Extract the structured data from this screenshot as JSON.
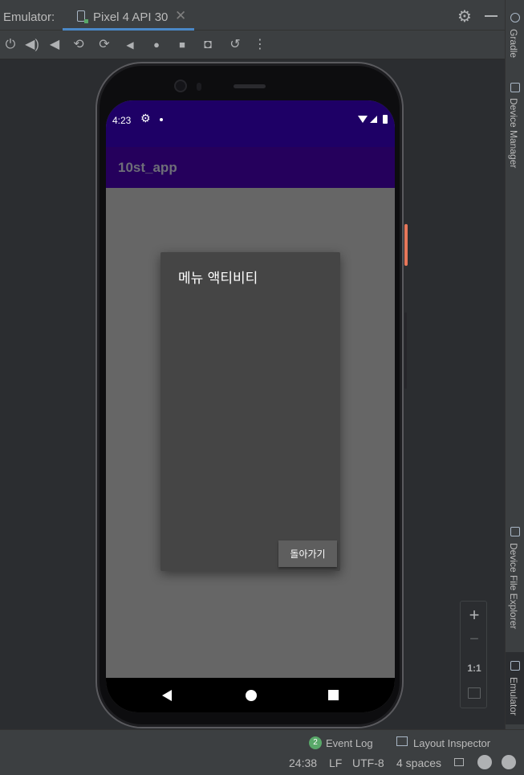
{
  "tabbar": {
    "emulator_label": "Emulator:",
    "tab_label": "Pixel 4 API 30",
    "tab_close": "✕",
    "settings_icon": "gear-icon",
    "minimize_icon": "minimize-icon"
  },
  "toolbar": {
    "buttons": [
      {
        "name": "power-icon",
        "glyph": "⏻"
      },
      {
        "name": "volume-up-icon",
        "glyph": "🔊"
      },
      {
        "name": "volume-down-icon",
        "glyph": "🔉"
      },
      {
        "name": "rotate-left-icon",
        "glyph": "⟲"
      },
      {
        "name": "rotate-right-icon",
        "glyph": "⟳"
      },
      {
        "name": "back-icon",
        "glyph": "◀"
      },
      {
        "name": "home-icon",
        "glyph": "●"
      },
      {
        "name": "overview-icon",
        "glyph": "■"
      },
      {
        "name": "camera-icon",
        "glyph": "📷"
      },
      {
        "name": "snapshot-icon",
        "glyph": "⟲"
      },
      {
        "name": "more-icon",
        "glyph": "⋮"
      }
    ]
  },
  "right_stripe": {
    "gradle": "Gradle",
    "device_manager": "Device Manager",
    "device_file_explorer": "Device File Explorer",
    "emulator": "Emulator"
  },
  "device": {
    "status": {
      "time": "4:23"
    },
    "app_title": "10st_app",
    "dialog": {
      "title": "메뉴 액티비티",
      "button_label": "돌아가기"
    }
  },
  "zoom": {
    "plus": "+",
    "minus": "−",
    "one_to_one": "1:1"
  },
  "bottom": {
    "event_count": "2",
    "event_log": "Event Log",
    "layout_inspector": "Layout Inspector",
    "position": "24:38",
    "line_sep": "LF",
    "encoding": "UTF-8",
    "indent": "4 spaces"
  },
  "colors": {
    "ide_background": "#2b2d30",
    "ide_panel": "#3c3f41",
    "status_bar": "#1e0066",
    "app_bar": "#25005c",
    "screen_bg": "#666666",
    "dialog_bg": "#454545",
    "accent_tab": "#4a88c7",
    "side_button": "#e8775a"
  }
}
